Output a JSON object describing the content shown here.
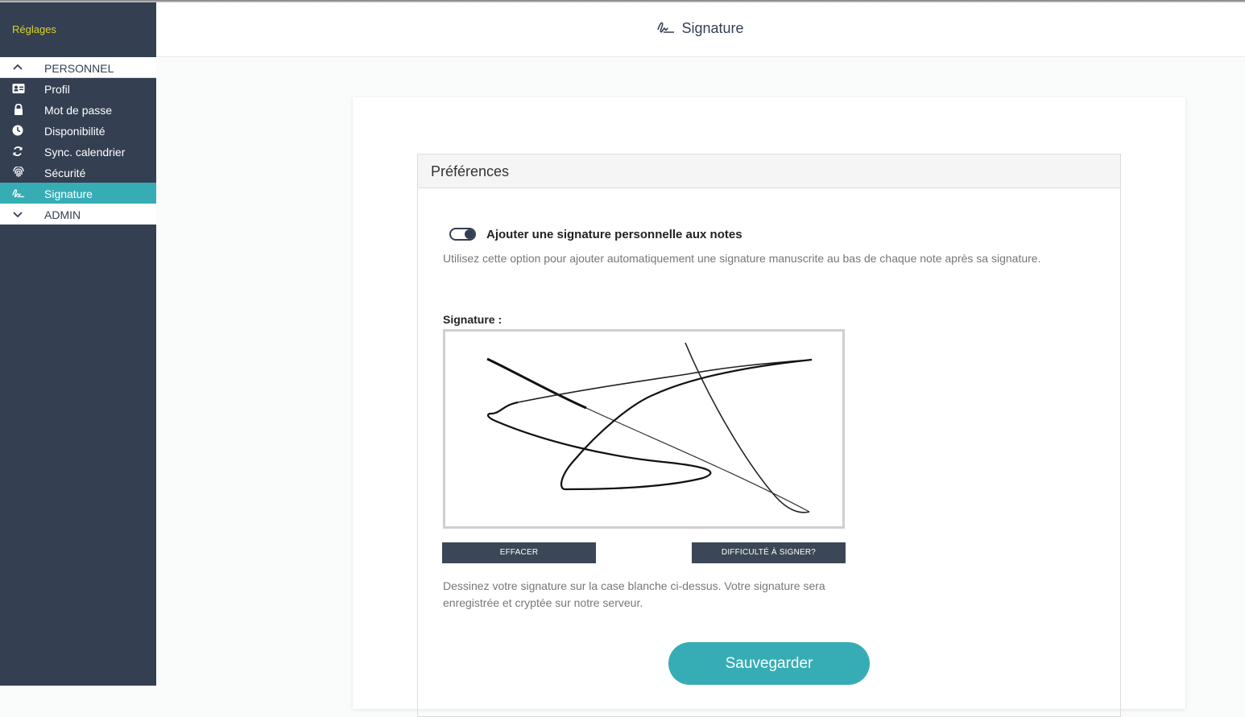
{
  "sidebar": {
    "brand": "Réglages",
    "personnel_label": "PERSONNEL",
    "admin_label": "ADMIN",
    "items": [
      {
        "label": "Profil",
        "icon": "id-card-icon"
      },
      {
        "label": "Mot de passe",
        "icon": "lock-icon"
      },
      {
        "label": "Disponibilité",
        "icon": "clock-icon"
      },
      {
        "label": "Sync. calendrier",
        "icon": "sync-icon"
      },
      {
        "label": "Sécurité",
        "icon": "fingerprint-icon"
      },
      {
        "label": "Signature",
        "icon": "signature-icon",
        "active": true
      }
    ]
  },
  "header": {
    "title": "Signature",
    "icon": "signature-icon"
  },
  "panel": {
    "title": "Préférences",
    "toggle_label": "Ajouter une signature personnelle aux notes",
    "toggle_on": true,
    "toggle_desc": "Utilisez cette option pour ajouter automatiquement une signature manuscrite au bas de chaque note après sa signature.",
    "signature_label": "Signature :",
    "clear_button": "EFFACER",
    "help_button": "DIFFICULTÉ À SIGNER?",
    "hint": "Dessinez votre signature sur la case blanche ci-dessus. Votre signature sera enregistrée et cryptée sur notre serveur.",
    "save_button": "Sauvegarder"
  },
  "colors": {
    "sidebar_bg": "#343f52",
    "accent": "#36adb5",
    "brand_text": "#d8d42a",
    "dark_button": "#3b4756"
  }
}
